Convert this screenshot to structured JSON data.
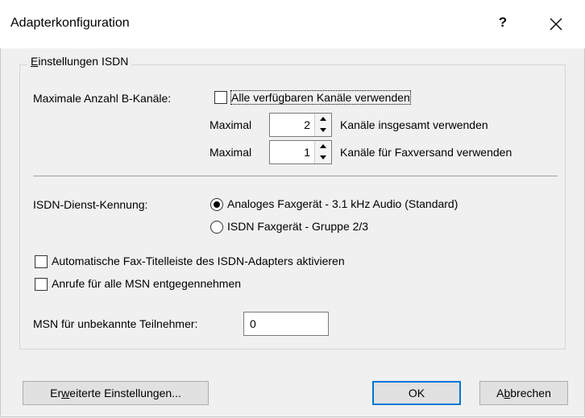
{
  "window": {
    "title": "Adapterkonfiguration",
    "help_label": "?"
  },
  "group": {
    "legend_pre": "",
    "legend_key": "E",
    "legend_post": "instellungen ISDN"
  },
  "channels": {
    "label": "Maximale Anzahl B-Kanäle:",
    "all_checkbox_label": "Alle verfügbaren Kanäle verwenden",
    "all_checked": false,
    "total": {
      "prefix": "Maximal",
      "value": "2",
      "suffix": "Kanäle insgesamt verwenden"
    },
    "fax": {
      "prefix": "Maximal",
      "value": "1",
      "suffix": "Kanäle für Faxversand verwenden"
    }
  },
  "service": {
    "label": "ISDN-Dienst-Kennung:",
    "options": [
      {
        "label": "Analoges Faxgerät - 3.1 kHz Audio (Standard)",
        "selected": true
      },
      {
        "label": "ISDN Faxgerät - Gruppe 2/3",
        "selected": false
      }
    ]
  },
  "checkboxes": [
    {
      "label": "Automatische Fax-Titelleiste des ISDN-Adapters aktivieren",
      "checked": false
    },
    {
      "label": "Anrufe für alle MSN entgegennehmen",
      "checked": false
    }
  ],
  "msn": {
    "label": "MSN für unbekannte Teilnehmer:",
    "value": "0"
  },
  "buttons": {
    "advanced": {
      "pre": "Er",
      "key": "w",
      "post": "eiterte Einstellungen..."
    },
    "ok": "OK",
    "cancel": {
      "pre": "A",
      "key": "b",
      "post": "brechen"
    }
  },
  "colors": {
    "accent": "#0078d7",
    "window_bg": "#f0f0f0",
    "titlebar_bg": "#ffffff"
  }
}
